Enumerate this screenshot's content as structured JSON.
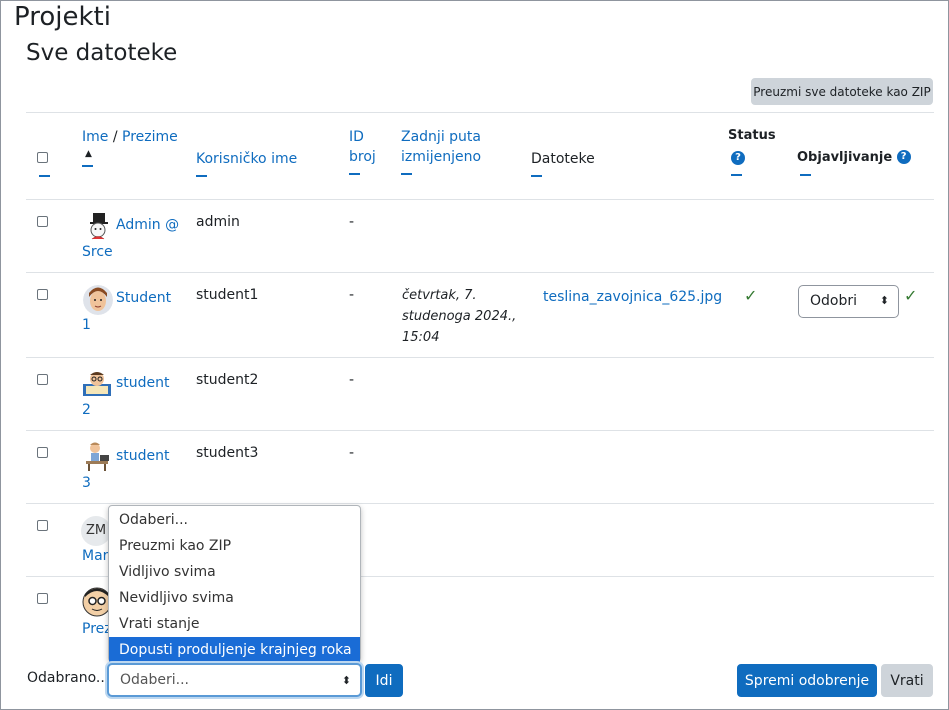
{
  "page": {
    "title": "Projekti",
    "section": "Sve datoteke"
  },
  "download_all_label": "Preuzmi sve datoteke kao ZIP",
  "table": {
    "headers": {
      "first_name": "Ime",
      "separator": " / ",
      "last_name": "Prezime",
      "sort_indicator": "▲",
      "username": "Korisničko ime",
      "id": "ID broj",
      "last_modified": "Zadnji puta izmijenjeno",
      "files": "Datoteke",
      "status": "Status",
      "publishing": "Objavljivanje"
    },
    "rows": [
      {
        "name": "Admin @ Srce",
        "name_l1": "Admin @",
        "name_l2": "Srce",
        "username": "admin",
        "id": "-",
        "modified": "",
        "file": "",
        "status": "",
        "approval": "",
        "avatar": "top-hat-avatar-icon"
      },
      {
        "name": "Student 1",
        "name_l1": "Student",
        "name_l2": "1",
        "username": "student1",
        "id": "-",
        "modified": "četvrtak, 7. studenoga 2024., 15:04",
        "mod_l1": "četvrtak, 7.",
        "mod_l2": "studenoga 2024.,",
        "mod_l3": "15:04",
        "file": "teslina_zavojnica_625.jpg",
        "status": "✓",
        "approval": "Odobri",
        "approval_check": "✓",
        "avatar": "face-avatar-icon"
      },
      {
        "name": "student 2",
        "name_l1": "student",
        "name_l2": "2",
        "username": "student2",
        "id": "-",
        "avatar": "reading-avatar-icon"
      },
      {
        "name": "student 3",
        "name_l1": "student",
        "name_l2": "3",
        "username": "student3",
        "id": "-",
        "avatar": "desk-avatar-icon"
      },
      {
        "initials": "ZM",
        "name_l2_partial": "Mar",
        "avatar": "initials-avatar"
      },
      {
        "name_l2_partial": "Prez",
        "avatar": "glasses-avatar-icon"
      }
    ]
  },
  "bulk": {
    "label": "Odabrano...",
    "select_value": "Odaberi...",
    "options": [
      "Odaberi...",
      "Preuzmi kao ZIP",
      "Vidljivo svima",
      "Nevidljivo svima",
      "Vrati stanje",
      "Dopusti produljenje krajnjeg roka"
    ],
    "selected_option_index": 5,
    "go_label": "Idi"
  },
  "actions": {
    "save_label": "Spremi odobrenje",
    "revert_label": "Vrati"
  },
  "colors": {
    "link": "#0f6cbf",
    "primary": "#0f6cbf",
    "secondary": "#ced4da",
    "highlight": "#1a6cd6",
    "check": "#357a32"
  }
}
